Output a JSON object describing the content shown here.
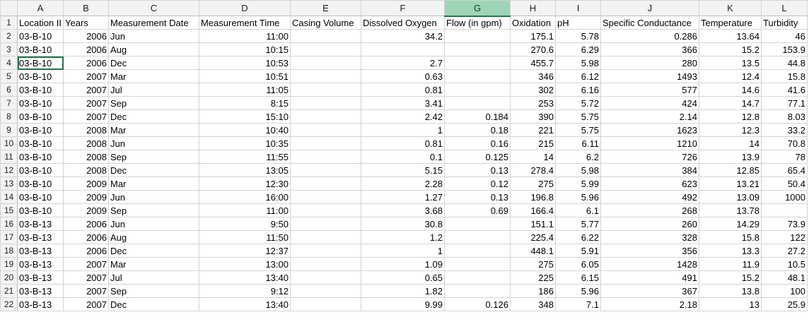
{
  "colors": {
    "header_bg": "#f3f3f3",
    "selected_col_bg": "#9fd5b7",
    "gridline": "#d4d4d4",
    "accent": "#217346"
  },
  "selected_column": "G",
  "active_cell": "A4",
  "columns": [
    "A",
    "B",
    "C",
    "D",
    "E",
    "F",
    "G",
    "H",
    "I",
    "J",
    "K",
    "L"
  ],
  "header_row": [
    "Location II",
    "Years",
    "Measurement Date",
    "Measurement Time",
    "Casing Volume",
    "Dissolved Oxygen",
    "Flow (in gpm)",
    "Oxidation",
    "pH",
    "Specific Conductance",
    "Temperature",
    "Turbidity"
  ],
  "rows": [
    [
      "03-B-10",
      "2006",
      "Jun",
      "11:00",
      "",
      "34.2",
      "",
      "175.1",
      "5.78",
      "0.286",
      "13.64",
      "46"
    ],
    [
      "03-B-10",
      "2006",
      "Aug",
      "10:15",
      "",
      "",
      "",
      "270.6",
      "6.29",
      "366",
      "15.2",
      "153.9"
    ],
    [
      "03-B-10",
      "2006",
      "Dec",
      "10:53",
      "",
      "2.7",
      "",
      "455.7",
      "5.98",
      "280",
      "13.5",
      "44.8"
    ],
    [
      "03-B-10",
      "2007",
      "Mar",
      "10:51",
      "",
      "0.63",
      "",
      "346",
      "6.12",
      "1493",
      "12.4",
      "15.8"
    ],
    [
      "03-B-10",
      "2007",
      "Jul",
      "11:05",
      "",
      "0.81",
      "",
      "302",
      "6.16",
      "577",
      "14.6",
      "41.6"
    ],
    [
      "03-B-10",
      "2007",
      "Sep",
      "8:15",
      "",
      "3.41",
      "",
      "253",
      "5.72",
      "424",
      "14.7",
      "77.1"
    ],
    [
      "03-B-10",
      "2007",
      "Dec",
      "15:10",
      "",
      "2.42",
      "0.184",
      "390",
      "5.75",
      "2.14",
      "12.8",
      "8.03"
    ],
    [
      "03-B-10",
      "2008",
      "Mar",
      "10:40",
      "",
      "1",
      "0.18",
      "221",
      "5.75",
      "1623",
      "12.3",
      "33.2"
    ],
    [
      "03-B-10",
      "2008",
      "Jun",
      "10:35",
      "",
      "0.81",
      "0.16",
      "215",
      "6.11",
      "1210",
      "14",
      "70.8"
    ],
    [
      "03-B-10",
      "2008",
      "Sep",
      "11:55",
      "",
      "0.1",
      "0.125",
      "14",
      "6.2",
      "726",
      "13.9",
      "78"
    ],
    [
      "03-B-10",
      "2008",
      "Dec",
      "13:05",
      "",
      "5.15",
      "0.13",
      "278.4",
      "5.98",
      "384",
      "12.85",
      "65.4"
    ],
    [
      "03-B-10",
      "2009",
      "Mar",
      "12:30",
      "",
      "2.28",
      "0.12",
      "275",
      "5.99",
      "623",
      "13.21",
      "50.4"
    ],
    [
      "03-B-10",
      "2009",
      "Jun",
      "16:00",
      "",
      "1.27",
      "0.13",
      "196.8",
      "5.96",
      "492",
      "13.09",
      "1000"
    ],
    [
      "03-B-10",
      "2009",
      "Sep",
      "11:00",
      "",
      "3.68",
      "0.69",
      "166.4",
      "6.1",
      "268",
      "13.78",
      ""
    ],
    [
      "03-B-13",
      "2006",
      "Jun",
      "9:50",
      "",
      "30.8",
      "",
      "151.1",
      "5.77",
      "260",
      "14.29",
      "73.9"
    ],
    [
      "03-B-13",
      "2006",
      "Aug",
      "11:50",
      "",
      "1.2",
      "",
      "225.4",
      "6.22",
      "328",
      "15.8",
      "122"
    ],
    [
      "03-B-13",
      "2006",
      "Dec",
      "12:37",
      "",
      "1",
      "",
      "448.1",
      "5.91",
      "356",
      "13.3",
      "27.2"
    ],
    [
      "03-B-13",
      "2007",
      "Mar",
      "13:00",
      "",
      "1.09",
      "",
      "275",
      "6.05",
      "1428",
      "11.9",
      "10.5"
    ],
    [
      "03-B-13",
      "2007",
      "Jul",
      "13:40",
      "",
      "0.65",
      "",
      "225",
      "6.15",
      "491",
      "15.2",
      "48.1"
    ],
    [
      "03-B-13",
      "2007",
      "Sep",
      "9:12",
      "",
      "1.82",
      "",
      "186",
      "5.96",
      "367",
      "13.8",
      "100"
    ],
    [
      "03-B-13",
      "2007",
      "Dec",
      "13:40",
      "",
      "9.99",
      "0.126",
      "348",
      "7.1",
      "2.18",
      "13",
      "25.9"
    ]
  ]
}
